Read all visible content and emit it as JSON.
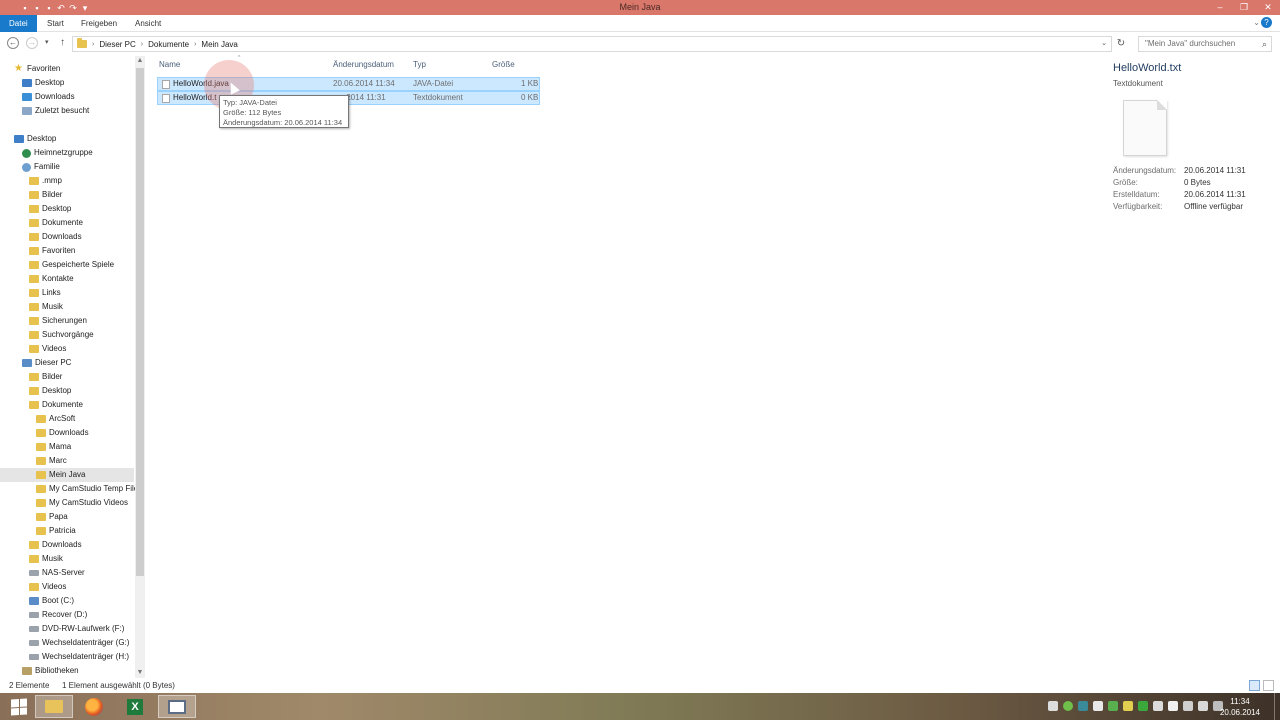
{
  "window": {
    "title": "Mein Java",
    "controls": [
      "–",
      "❐",
      "✕"
    ]
  },
  "ribbon": {
    "tabs": [
      "Datei",
      "Start",
      "Freigeben",
      "Ansicht"
    ]
  },
  "address": {
    "crumbs": [
      "Dieser PC",
      "Dokumente",
      "Mein Java"
    ],
    "search_placeholder": "\"Mein Java\" durchsuchen"
  },
  "nav": {
    "items": [
      {
        "label": "Favoriten",
        "icon": "star-icon"
      },
      {
        "label": "Desktop",
        "icon": "desktop-icon"
      },
      {
        "label": "Downloads",
        "icon": "downloads-icon"
      },
      {
        "label": "Zuletzt besucht",
        "icon": "recent-icon"
      },
      {
        "label": "Desktop",
        "icon": "desktop-icon"
      },
      {
        "label": "Heimnetzgruppe",
        "icon": "homegroup-icon"
      },
      {
        "label": "Familie",
        "icon": "user-icon"
      },
      {
        "label": ".mmp",
        "icon": "folder-icon"
      },
      {
        "label": "Bilder",
        "icon": "folder-icon"
      },
      {
        "label": "Desktop",
        "icon": "folder-icon"
      },
      {
        "label": "Dokumente",
        "icon": "folder-icon"
      },
      {
        "label": "Downloads",
        "icon": "folder-icon"
      },
      {
        "label": "Favoriten",
        "icon": "folder-icon"
      },
      {
        "label": "Gespeicherte Spiele",
        "icon": "folder-icon"
      },
      {
        "label": "Kontakte",
        "icon": "folder-icon"
      },
      {
        "label": "Links",
        "icon": "folder-icon"
      },
      {
        "label": "Musik",
        "icon": "folder-icon"
      },
      {
        "label": "Sicherungen",
        "icon": "folder-icon"
      },
      {
        "label": "Suchvorgänge",
        "icon": "folder-icon"
      },
      {
        "label": "Videos",
        "icon": "folder-icon"
      },
      {
        "label": "Dieser PC",
        "icon": "computer-icon"
      },
      {
        "label": "Bilder",
        "icon": "folder-icon"
      },
      {
        "label": "Desktop",
        "icon": "folder-icon"
      },
      {
        "label": "Dokumente",
        "icon": "folder-icon"
      },
      {
        "label": "ArcSoft",
        "icon": "folder-icon"
      },
      {
        "label": "Downloads",
        "icon": "folder-icon"
      },
      {
        "label": "Mama",
        "icon": "folder-icon"
      },
      {
        "label": "Marc",
        "icon": "folder-icon"
      },
      {
        "label": "Mein Java",
        "icon": "folder-icon"
      },
      {
        "label": "My CamStudio Temp Files",
        "icon": "folder-icon"
      },
      {
        "label": "My CamStudio Videos",
        "icon": "folder-icon"
      },
      {
        "label": "Papa",
        "icon": "folder-icon"
      },
      {
        "label": "Patricia",
        "icon": "folder-icon"
      },
      {
        "label": "Downloads",
        "icon": "folder-icon"
      },
      {
        "label": "Musik",
        "icon": "folder-icon"
      },
      {
        "label": "NAS-Server",
        "icon": "network-drive-icon"
      },
      {
        "label": "Videos",
        "icon": "folder-icon"
      },
      {
        "label": "Boot (C:)",
        "icon": "drive-icon"
      },
      {
        "label": "Recover (D:)",
        "icon": "drive-icon"
      },
      {
        "label": "DVD-RW-Laufwerk (F:)",
        "icon": "dvd-icon"
      },
      {
        "label": "Wechseldatenträger (G:)",
        "icon": "removable-drive-icon"
      },
      {
        "label": "Wechseldatenträger (H:)",
        "icon": "removable-drive-icon"
      },
      {
        "label": "Bibliotheken",
        "icon": "library-icon"
      }
    ]
  },
  "list": {
    "columns": [
      "Name",
      "Änderungsdatum",
      "Typ",
      "Größe"
    ],
    "rows": [
      {
        "name": "HelloWorld.java",
        "date": "20.06.2014 11:34",
        "type": "JAVA-Datei",
        "size": "1 KB"
      },
      {
        "name": "HelloWorld.txt",
        "date": "20.06.2014 11:31",
        "type": "Textdokument",
        "size": "0 KB"
      }
    ],
    "row2_name_visible": "HelloWorld.t",
    "row2_date_visible": ".2014 11:31"
  },
  "tooltip": {
    "line1": "Typ: JAVA-Datei",
    "line2": "Größe: 112 Bytes",
    "line3": "Änderungsdatum: 20.06.2014 11:34"
  },
  "preview": {
    "title": "HelloWorld.txt",
    "subtitle": "Textdokument",
    "props": [
      {
        "label": "Änderungsdatum:",
        "value": "20.06.2014 11:31"
      },
      {
        "label": "Größe:",
        "value": "0 Bytes"
      },
      {
        "label": "Erstelldatum:",
        "value": "20.06.2014 11:31"
      },
      {
        "label": "Verfügbarkeit:",
        "value": "Offline verfügbar"
      }
    ]
  },
  "status": {
    "count": "2 Elemente",
    "selection": "1 Element ausgewählt (0 Bytes)"
  },
  "taskbar": {
    "time": "11:34",
    "date": "20.06.2014"
  },
  "colors": {
    "titlebar": "#d9776a",
    "file_tab": "#1979ca",
    "selection": "#cce8ff"
  }
}
